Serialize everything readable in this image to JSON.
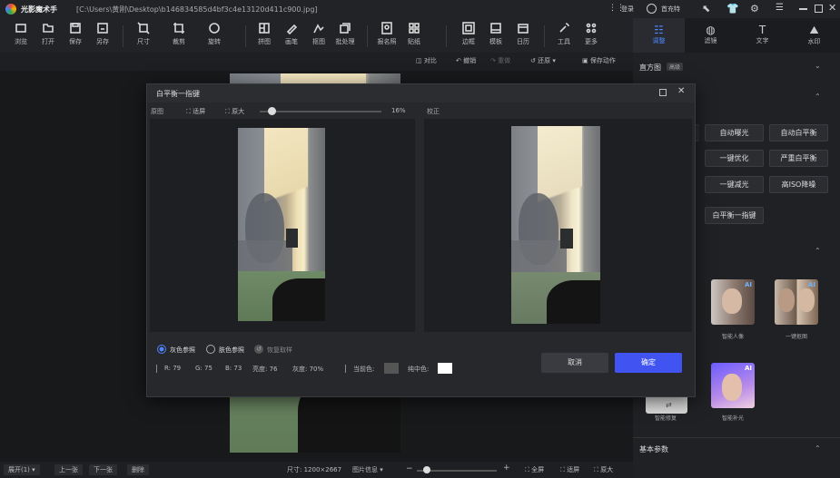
{
  "titlebar": {
    "app_name": "光影魔术手",
    "file_path": "[C:\\Users\\黄刚\\Desktop\\b146834585d4bf3c4e13120d411c900.jpg]",
    "login": "登录",
    "vip": "首充特"
  },
  "toolbar": {
    "items": [
      "浏览",
      "打开",
      "保存",
      "另存",
      "尺寸",
      "裁剪",
      "旋转",
      "拼图",
      "画笔",
      "抠图",
      "批处理",
      "报名照",
      "贴纸",
      "边框",
      "模板",
      "日历",
      "工具",
      "更多"
    ]
  },
  "subbar": {
    "compare": "对比",
    "undo": "撤销",
    "redo": "重做",
    "restore": "还原",
    "save_action": "保存动作"
  },
  "right_panel": {
    "tabs": [
      "调整",
      "滤镜",
      "文字",
      "水印"
    ],
    "histogram": "直方图",
    "histogram_tag": "高级",
    "buttons": [
      "自动曝光",
      "自动白平衡",
      "一键优化",
      "严重白平衡",
      "一键减光",
      "高ISO降噪",
      "白平衡一指键"
    ],
    "ai_items": [
      "智能人像",
      "一键抠图",
      "智能补光",
      "智能修复"
    ],
    "basic_params": "基本参数"
  },
  "dialog": {
    "title": "白平衡一指键",
    "original_label": "原图",
    "fit_label": "适屏",
    "actual_label": "原大",
    "zoom_value": "16%",
    "corrected_label": "校正",
    "options": [
      "灰色参照",
      "肤色参照",
      "恢复取样"
    ],
    "stats": {
      "r": "R: 79",
      "g": "G: 75",
      "b": "B: 73",
      "luma": "亮度: 76",
      "gray": "灰度: 70%",
      "current_color_label": "当前色:",
      "current_color": "#555555",
      "neutral_color_label": "纯中色:",
      "neutral_color": "#ffffff"
    },
    "cancel": "取消",
    "confirm": "确定"
  },
  "statusbar": {
    "browse": "展开(1)",
    "prev": "上一张",
    "next": "下一张",
    "delete": "删除",
    "size": "尺寸: 1200×2667",
    "info": "图片信息",
    "fullscreen": "全屏",
    "fit": "适屏",
    "actual": "原大"
  },
  "colors": {
    "accent": "#4154f1",
    "bg": "#1b1c1f"
  }
}
